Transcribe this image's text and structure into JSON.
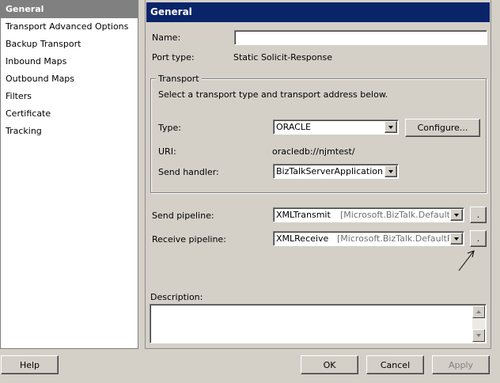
{
  "nav": {
    "items": [
      {
        "label": "General",
        "selected": true
      },
      {
        "label": "Transport Advanced Options",
        "selected": false
      },
      {
        "label": "Backup Transport",
        "selected": false
      },
      {
        "label": "Inbound Maps",
        "selected": false
      },
      {
        "label": "Outbound Maps",
        "selected": false
      },
      {
        "label": "Filters",
        "selected": false
      },
      {
        "label": "Certificate",
        "selected": false
      },
      {
        "label": "Tracking",
        "selected": false
      }
    ]
  },
  "panel": {
    "title": "General",
    "name_label": "Name:",
    "name_value": "",
    "port_type_label": "Port type:",
    "port_type_value": "Static Solicit-Response",
    "transport": {
      "group_title": "Transport",
      "instruction": "Select a transport type and transport address below.",
      "type_label": "Type:",
      "type_value": "ORACLE",
      "configure_label": "Configure...",
      "uri_label": "URI:",
      "uri_value": "oracledb://njmtest/",
      "send_handler_label": "Send handler:",
      "send_handler_value": "BizTalkServerApplication"
    },
    "send_pipeline_label": "Send pipeline:",
    "send_pipeline_name": "XMLTransmit",
    "send_pipeline_assembly": "[Microsoft.BizTalk.DefaultPipe",
    "send_pipeline_button": ".",
    "receive_pipeline_label": "Receive pipeline:",
    "receive_pipeline_name": "XMLReceive",
    "receive_pipeline_assembly": "[Microsoft.BizTalk.DefaultPipe",
    "receive_pipeline_button": ".",
    "description_label": "Description:",
    "description_value": ""
  },
  "footer": {
    "help_label": "Help",
    "ok_label": "OK",
    "cancel_label": "Cancel",
    "apply_label": "Apply"
  },
  "colors": {
    "header_bg": "#0a246a",
    "window_bg": "#d4d0c8",
    "selected_nav_bg": "#808080"
  }
}
